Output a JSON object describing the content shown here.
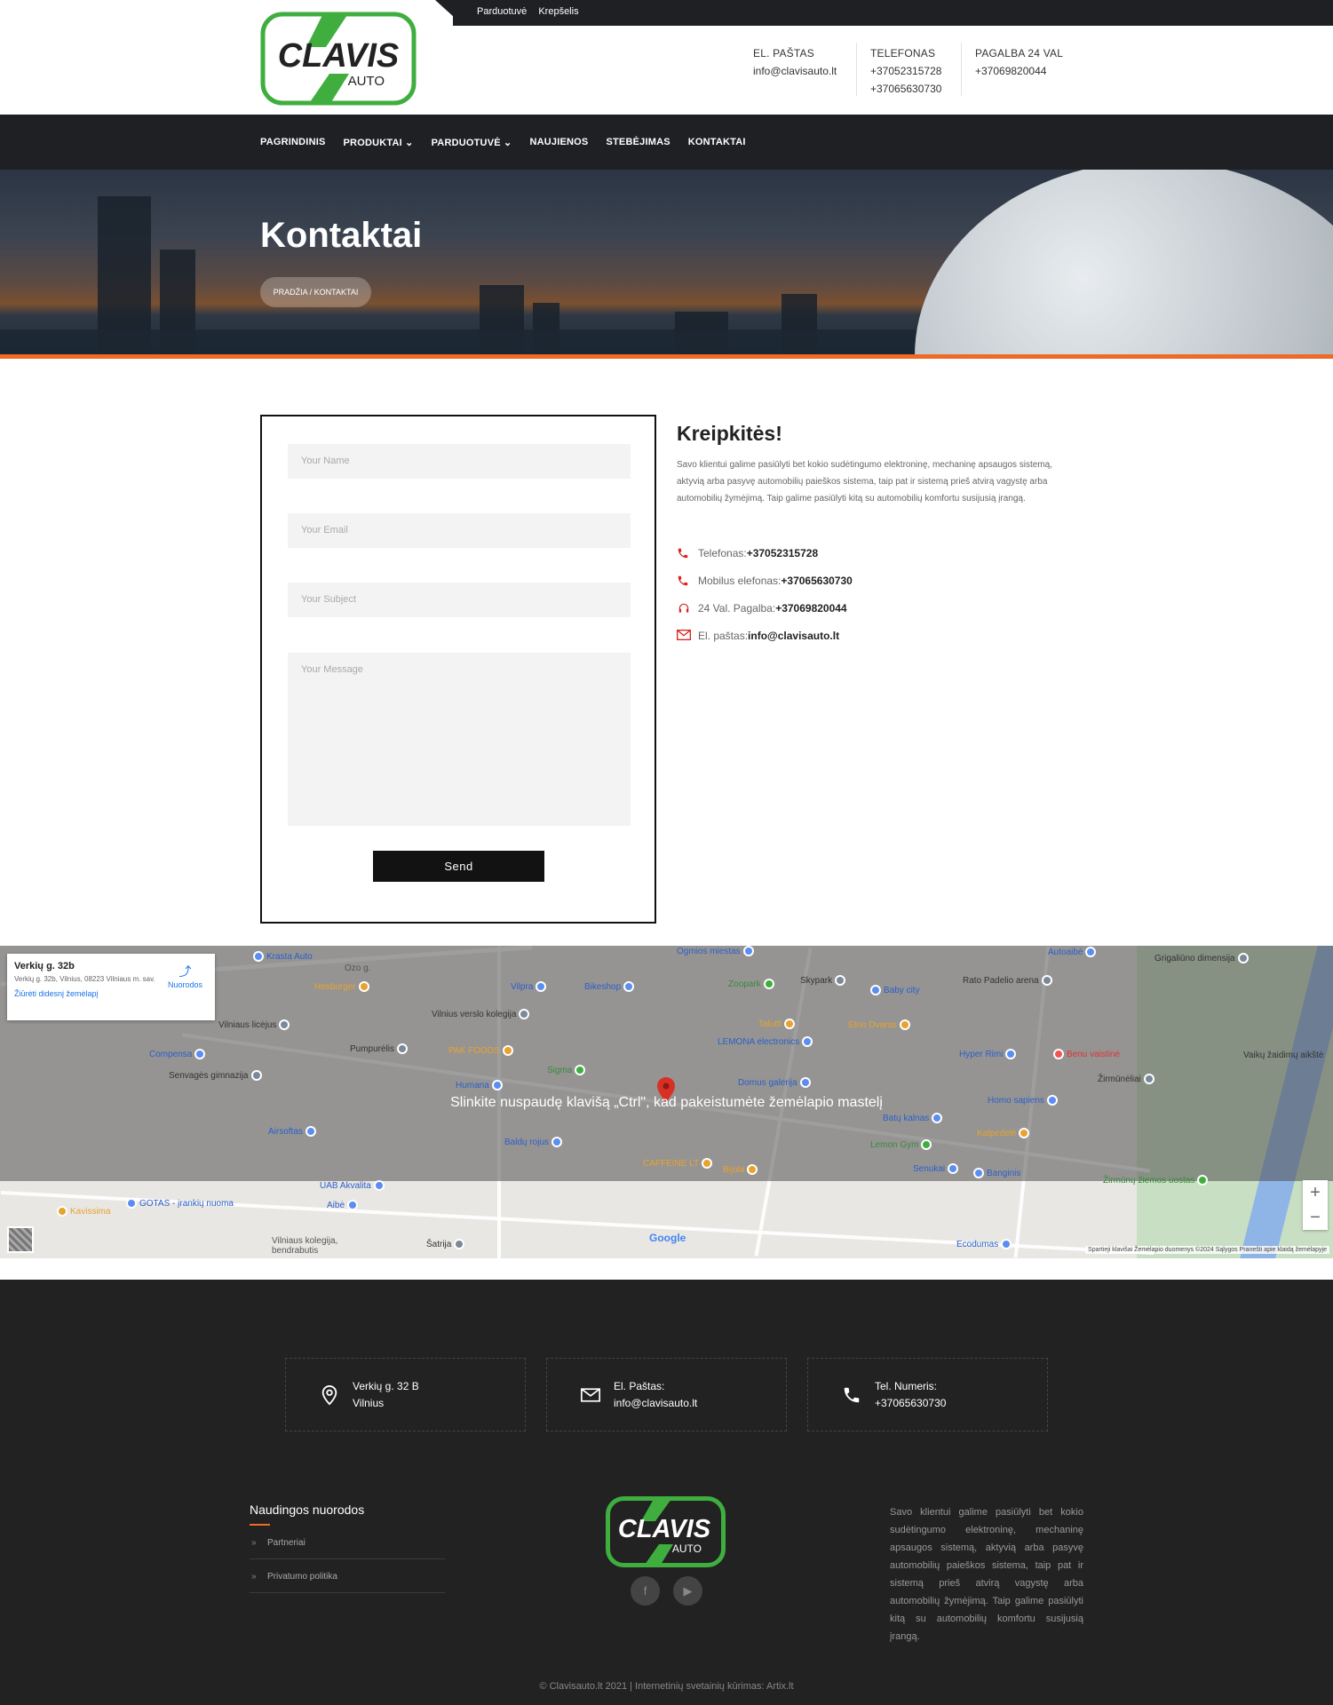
{
  "topbar": {
    "shop": "Parduotuvė",
    "cart": "Krepšelis"
  },
  "logo": {
    "main": "CLAVIS",
    "sub": "AUTO"
  },
  "header_contacts": [
    {
      "label": "EL. PAŠTAS",
      "values": [
        "info@clavisauto.lt"
      ]
    },
    {
      "label": "TELEFONAS",
      "values": [
        "+37052315728",
        "+37065630730"
      ]
    },
    {
      "label": "PAGALBA 24 VAL",
      "values": [
        "+37069820044"
      ]
    }
  ],
  "nav": [
    "PAGRINDINIS",
    "PRODUKTAI",
    "PARDUOTUVĖ",
    "NAUJIENOS",
    "STEBĖJIMAS",
    "KONTAKTAI"
  ],
  "hero": {
    "title": "Kontaktai",
    "breadcrumb": "PRADŽIA / KONTAKTAI"
  },
  "form": {
    "name": "Your Name",
    "email": "Your Email",
    "subject": "Your Subject",
    "message": "Your Message",
    "send": "Send"
  },
  "info": {
    "title": "Kreipkitės!",
    "text": "Savo klientui galime pasiūlyti bet kokio sudėtingumo elektroninę, mechaninę apsaugos sistemą, aktyvią arba pasyvę automobilių paieškos sistema, taip pat ir sistemą prieš atvirą vagystę arba automobilių žymėjimą. Taip galime pasiūlyti kitą su automobilių komfortu susijusią įrangą.",
    "rows": [
      {
        "label": "Telefonas: ",
        "value": "+37052315728"
      },
      {
        "label": "Mobilus elefonas:",
        "value": "+37065630730"
      },
      {
        "label": "24 Val. Pagalba: ",
        "value": "+37069820044"
      },
      {
        "label": "El. paštas: ",
        "value": "info@clavisauto.lt"
      }
    ]
  },
  "map": {
    "card_title": "Verkių g. 32b",
    "card_address": "Verkių g. 32b, Vilnius, 08223 Vilniaus m. sav.",
    "card_link": "Žiūrėti didesnį žemėlapį",
    "directions": "Nuorodos",
    "overlay": "Slinkite nuspaudę klavišą „Ctrl\", kad pakeistumėte žemėlapio mastelį",
    "attribution": "Spartieji klavišai   Žemėlapio duomenys ©2024   Sąlygos   Pranešti apie klaidą žemėlapyje",
    "pois": [
      "Krasta Auto",
      "Ozo g.",
      "Hesburger",
      "Vilnius verslo kolegija",
      "Vilniaus licėjus",
      "Pumpurėlis",
      "Compensa",
      "Senvagės gimnazija",
      "Vilpra",
      "Bikeshop",
      "Ogmios miestas",
      "Zoopark",
      "Skypark",
      "Baby city",
      "Rato Padelio arena",
      "Autoaibė",
      "Grigaliūno dimensija",
      "Talutti",
      "Etno Dvaras",
      "LEMONA electronics",
      "PAK FOODS",
      "Sigma",
      "Humana",
      "Domus galerija",
      "Hyper Rimi",
      "Benu vaistinė",
      "Žirmūnėliai",
      "Airsoftas",
      "Baldų rojus",
      "Batų kalnas",
      "Homo sapiens",
      "Kalpedelė",
      "Lemon Gym",
      "CAFFEINE LT",
      "Bijola",
      "Senukai",
      "Banginis",
      "GOTAS - įrankių nuoma",
      "UAB Akvalita",
      "Aibė",
      "Kavissima",
      "Vilniaus kolegija, bendrabutis",
      "Šatrija",
      "Ecodumas",
      "Žirmūnų žiemos uostas",
      "Vaikų žaidimų aikštė"
    ]
  },
  "footer": {
    "boxes": [
      {
        "label": "Verkių g. 32 B",
        "value": "Vilnius"
      },
      {
        "label": "El. Paštas:",
        "value": "info@clavisauto.lt"
      },
      {
        "label": "Tel. Numeris:",
        "value": "+37065630730"
      }
    ],
    "useful_title": "Naudingos nuorodos",
    "links": [
      "Partneriai",
      "Privatumo politika"
    ],
    "social": [
      "f",
      "▶"
    ],
    "desc": "Savo klientui galime pasiūlyti bet kokio sudėtingumo elektroninę, mechaninę apsaugos sistemą, aktyvią arba pasyvę automobilių paieškos sistema, taip pat ir sistemą prieš atvirą vagystę arba automobilių žymėjimą. Taip galime pasiūlyti kitą su automobilių komfortu susijusią įrangą.",
    "copyright": "© Clavisauto.lt 2021 | Internetinių svetainių kūrimas: Artix.lt"
  },
  "colors": {
    "accent": "#f06a26",
    "brand_green": "#3fae3f",
    "dark": "#1f2024"
  }
}
